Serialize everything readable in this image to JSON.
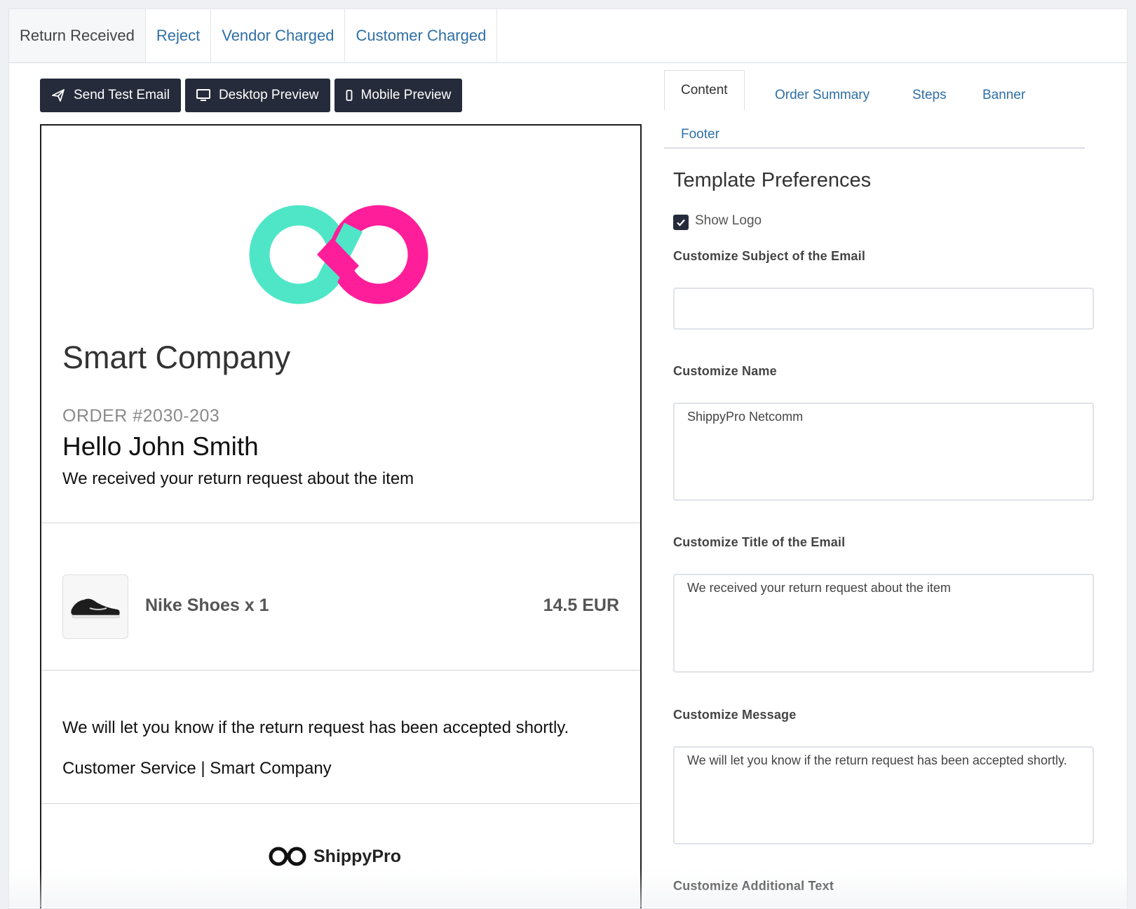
{
  "top_tabs": [
    {
      "label": "Return Received",
      "active": true
    },
    {
      "label": "Reject"
    },
    {
      "label": "Vendor Charged"
    },
    {
      "label": "Customer Charged"
    }
  ],
  "toolbar": {
    "send_test_email": "Send Test Email",
    "desktop_preview": "Desktop Preview",
    "mobile_preview": "Mobile Preview"
  },
  "preview": {
    "company": "Smart Company",
    "order": "ORDER #2030-203",
    "greeting": "Hello John Smith",
    "title": "We received your return request about the item",
    "item": {
      "name": "Nike Shoes x 1",
      "price": "14.5 EUR"
    },
    "message": "We will let you know if the return request has been accepted shortly.",
    "signature": "Customer Service | Smart Company",
    "footer_brand": "ShippyPro"
  },
  "right_tabs": [
    {
      "label": "Content",
      "active": true
    },
    {
      "label": "Order Summary"
    },
    {
      "label": "Steps"
    },
    {
      "label": "Banner"
    },
    {
      "label": "Footer"
    }
  ],
  "panel": {
    "title": "Template Preferences",
    "show_logo_label": "Show Logo",
    "show_logo_checked": true,
    "subject_label": "Customize Subject of the Email",
    "subject_value": "",
    "name_label": "Customize Name",
    "name_value": "ShippyPro Netcomm",
    "email_title_label": "Customize Title of the Email",
    "email_title_value": "We received your return request about the item",
    "message_label": "Customize Message",
    "message_value": "We will let you know if the return request has been accepted shortly.",
    "additional_label": "Customize Additional Text"
  },
  "colors": {
    "dark_button": "#262b3b",
    "link_blue": "#2f6fa4",
    "logo_teal": "#4fe6c8",
    "logo_pink": "#ff1e9a"
  }
}
